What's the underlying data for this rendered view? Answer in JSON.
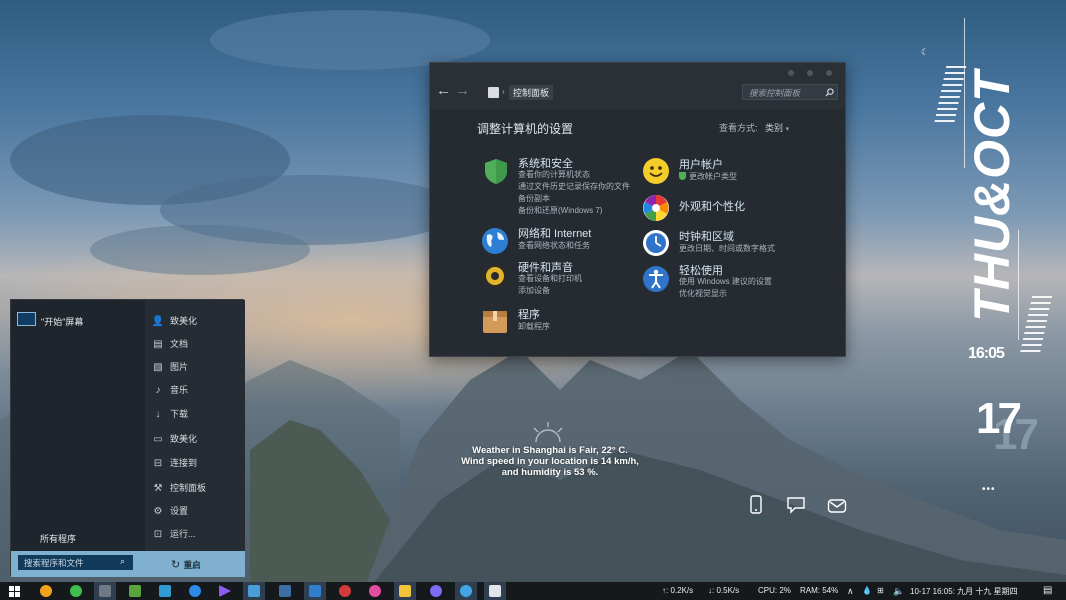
{
  "control_panel": {
    "breadcrumb": "控制面板",
    "search_placeholder": "搜索控制面板",
    "title": "调整计算机的设置",
    "view_by_label": "查看方式:",
    "view_by_value": "类别",
    "categories": [
      {
        "title": "系统和安全",
        "links": [
          "查看你的计算机状态",
          "通过文件历史记录保存你的文件",
          "备份副本",
          "备份和还原(Windows 7)"
        ]
      },
      {
        "title": "网络和 Internet",
        "links": [
          "查看网络状态和任务"
        ]
      },
      {
        "title": "硬件和声音",
        "links": [
          "查看设备和打印机",
          "添加设备"
        ]
      },
      {
        "title": "程序",
        "links": [
          "卸载程序"
        ]
      },
      {
        "title": "用户帐户",
        "links": [
          "更改帐户类型"
        ]
      },
      {
        "title": "外观和个性化",
        "links": []
      },
      {
        "title": "时钟和区域",
        "links": [
          "更改日期、时间或数字格式"
        ]
      },
      {
        "title": "轻松使用",
        "links": [
          "使用 Windows 建议的设置",
          "优化视觉显示"
        ]
      }
    ]
  },
  "start_menu": {
    "pinned_label": "\"开始\"屏幕",
    "all_programs": "所有程序",
    "search_placeholder": "搜索程序和文件",
    "power_label": "重启",
    "right_items": [
      {
        "label": "致美化",
        "icon": "user-icon"
      },
      {
        "label": "文档",
        "icon": "document-icon"
      },
      {
        "label": "图片",
        "icon": "picture-icon"
      },
      {
        "label": "音乐",
        "icon": "music-icon"
      },
      {
        "label": "下载",
        "icon": "download-icon"
      },
      {
        "label": "致美化",
        "icon": "computer-icon"
      },
      {
        "label": "连接到",
        "icon": "connect-icon"
      },
      {
        "label": "控制面板",
        "icon": "wrench-icon"
      },
      {
        "label": "设置",
        "icon": "gear-icon"
      },
      {
        "label": "运行...",
        "icon": "run-icon"
      }
    ]
  },
  "desktop": {
    "weather_lines": [
      "Weather in Shanghai is Fair, 22° C.",
      "Wind speed in your location is 14 km/h,",
      "and humidity is 53 %."
    ],
    "widget_vertical_text": "THU&OCT",
    "widget_time": "16:05",
    "widget_day": "17",
    "widget_more": "•••"
  },
  "taskbar": {
    "upload": "↑: 0.2K/s",
    "download": "↓: 0.5K/s",
    "cpu": "CPU: 2%",
    "ram": "RAM: 54%",
    "datetime": "10-17  16:05:  九月 十九  星期四"
  },
  "colors": {
    "window_bg": "#262b31",
    "accent": "#7fb0cf",
    "taskbar": "#16191c"
  }
}
